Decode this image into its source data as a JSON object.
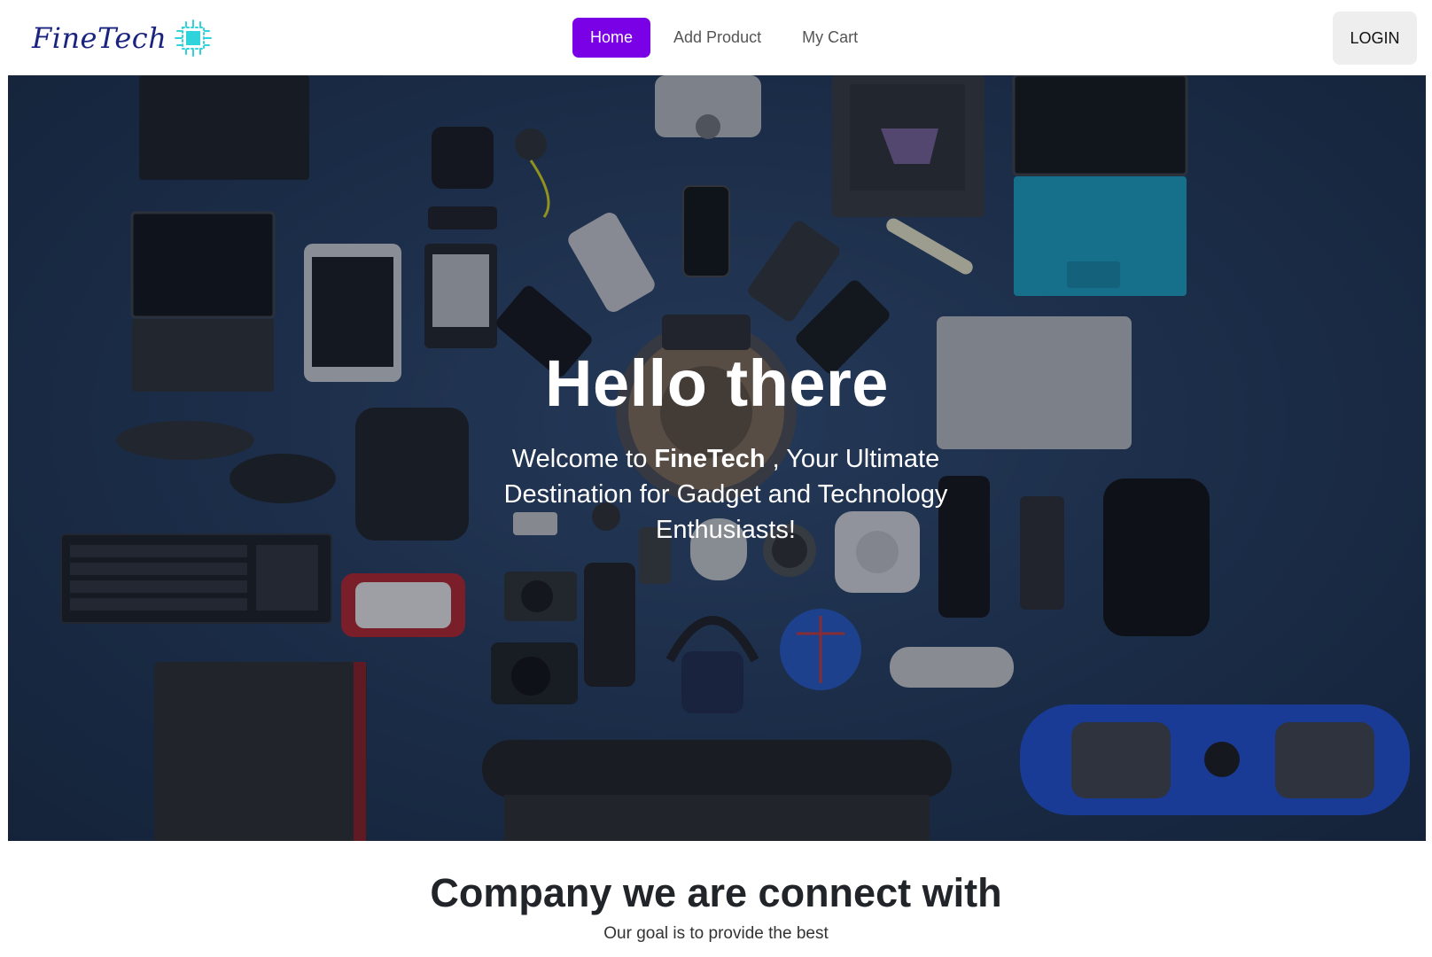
{
  "navbar": {
    "brand": "FineTech",
    "links": [
      {
        "label": "Home",
        "active": true
      },
      {
        "label": "Add Product",
        "active": false
      },
      {
        "label": "My Cart",
        "active": false
      }
    ],
    "login_label": "LOGIN",
    "accent_color": "#7a00e6"
  },
  "hero": {
    "title": "Hello there",
    "subtitle_pre": "Welcome to ",
    "subtitle_brand": "FineTech",
    "subtitle_post": " , Your Ultimate Destination for Gadget and Technology Enthusiasts!"
  },
  "company": {
    "title": "Company we are connect with",
    "subtitle": "Our goal is to provide the best"
  }
}
